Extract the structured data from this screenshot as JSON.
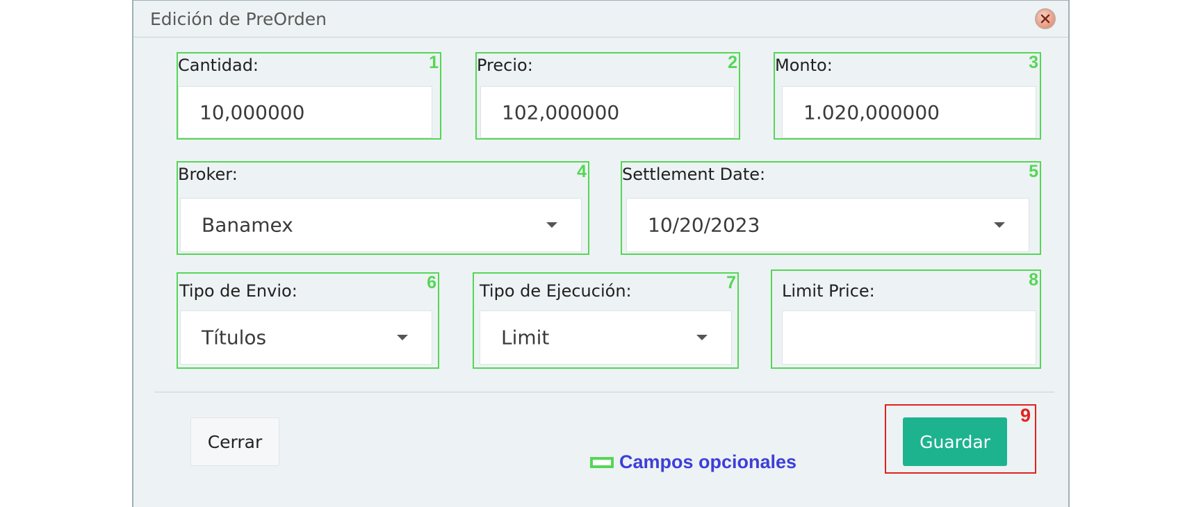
{
  "dialog": {
    "title": "Edición de PreOrden",
    "close_icon": "close-icon"
  },
  "fields": {
    "cantidad": {
      "num": "1",
      "label": "Cantidad:",
      "value": "10,000000"
    },
    "precio": {
      "num": "2",
      "label": "Precio:",
      "value": "102,000000"
    },
    "monto": {
      "num": "3",
      "label": "Monto:",
      "value": "1.020,000000"
    },
    "broker": {
      "num": "4",
      "label": "Broker:",
      "value": "Banamex"
    },
    "settlement": {
      "num": "5",
      "label": "Settlement Date:",
      "value": "10/20/2023"
    },
    "tipo_envio": {
      "num": "6",
      "label": "Tipo de Envio:",
      "value": "Títulos"
    },
    "tipo_ejecucion": {
      "num": "7",
      "label": "Tipo de Ejecución:",
      "value": "Limit"
    },
    "limit_price": {
      "num": "8",
      "label": "Limit Price:",
      "value": ""
    }
  },
  "footer": {
    "cerrar_label": "Cerrar",
    "guardar_label": "Guardar",
    "guardar_num": "9",
    "legend_text": "Campos opcionales"
  },
  "colors": {
    "optional_outline": "#55d656",
    "highlight_outline": "#e2211c",
    "primary_button": "#1eb38f",
    "legend_text": "#3c3fd8"
  }
}
